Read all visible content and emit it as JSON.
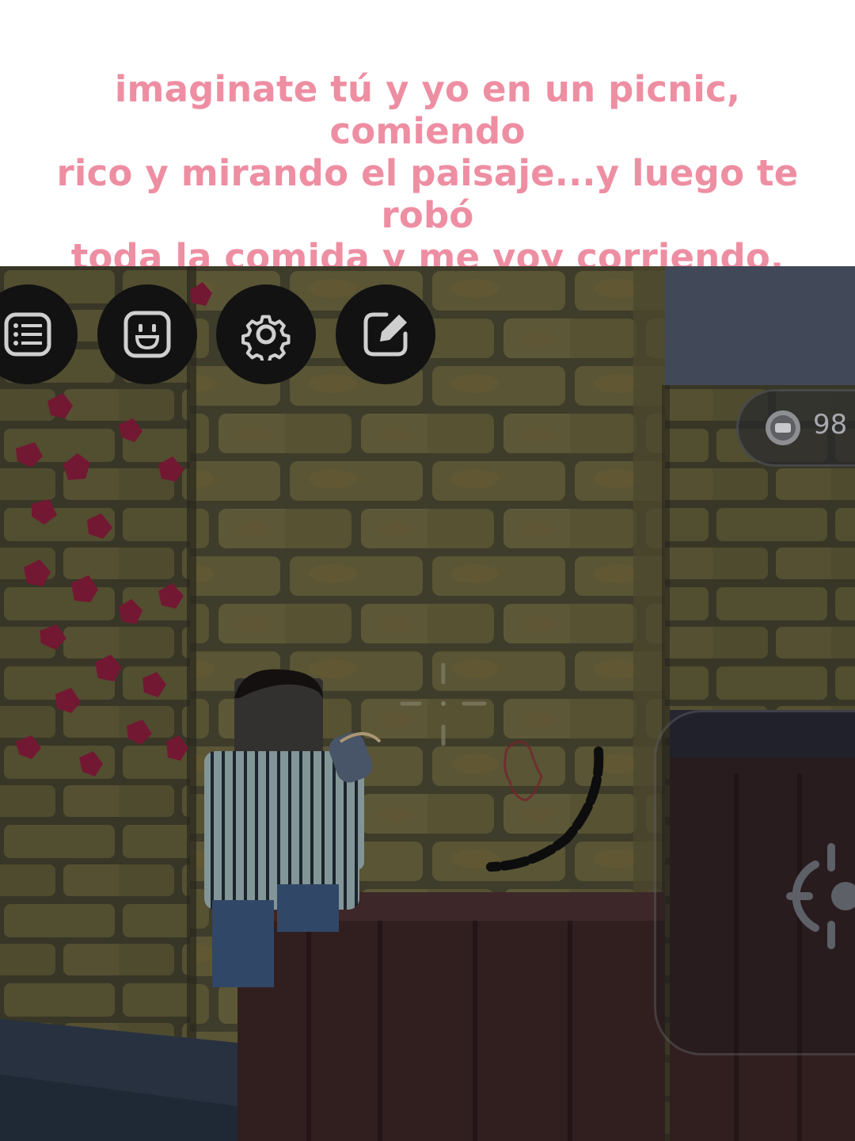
{
  "caption": {
    "line1": "imaginate tú y yo en un picnic, comiendo",
    "line2": "rico y mirando el paisaje...y luego te robó",
    "line3": "toda la comida y me voy corriendo."
  },
  "hud": {
    "buttons": [
      {
        "name": "menu-list-icon"
      },
      {
        "name": "emote-face-icon"
      },
      {
        "name": "settings-gear-icon"
      },
      {
        "name": "edit-pencil-icon"
      }
    ],
    "counter": {
      "icon": "coin-icon",
      "value": "98"
    }
  },
  "colors": {
    "caption_text": "#ee8ea2",
    "hud_button_bg": "#121212",
    "wall_stone": "#6e6a3e",
    "ivy": "#8a1b3a"
  }
}
